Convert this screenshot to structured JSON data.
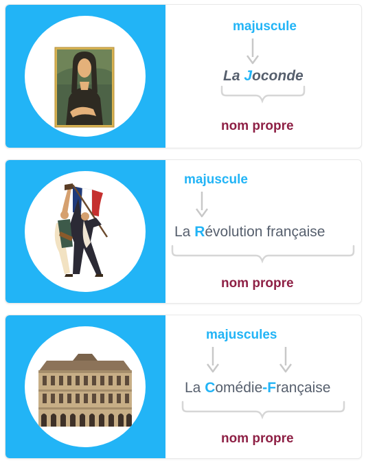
{
  "colors": {
    "accent": "#22b4f6",
    "proper_noun": "#8e2045",
    "text": "#565f6d",
    "arrow": "#c8c8c8"
  },
  "cards": [
    {
      "illustration": "mona-lisa-painting",
      "capital_label": "majuscule",
      "phrase": [
        {
          "text": "La ",
          "highlight": false
        },
        {
          "text": "J",
          "highlight": true
        },
        {
          "text": "oconde",
          "highlight": false
        }
      ],
      "noun_label": "nom propre"
    },
    {
      "illustration": "liberty-leading-the-people",
      "capital_label": "majuscule",
      "phrase": [
        {
          "text": "La ",
          "highlight": false
        },
        {
          "text": "R",
          "highlight": true
        },
        {
          "text": "évolution française",
          "highlight": false
        }
      ],
      "noun_label": "nom propre"
    },
    {
      "illustration": "comedie-francaise-building",
      "capital_label": "majuscules",
      "phrase": [
        {
          "text": "La ",
          "highlight": false
        },
        {
          "text": "C",
          "highlight": true
        },
        {
          "text": "omédie",
          "highlight": false
        },
        {
          "text": "-",
          "highlight": true
        },
        {
          "text": "F",
          "highlight": true
        },
        {
          "text": "rançaise",
          "highlight": false
        }
      ],
      "noun_label": "nom propre"
    }
  ]
}
